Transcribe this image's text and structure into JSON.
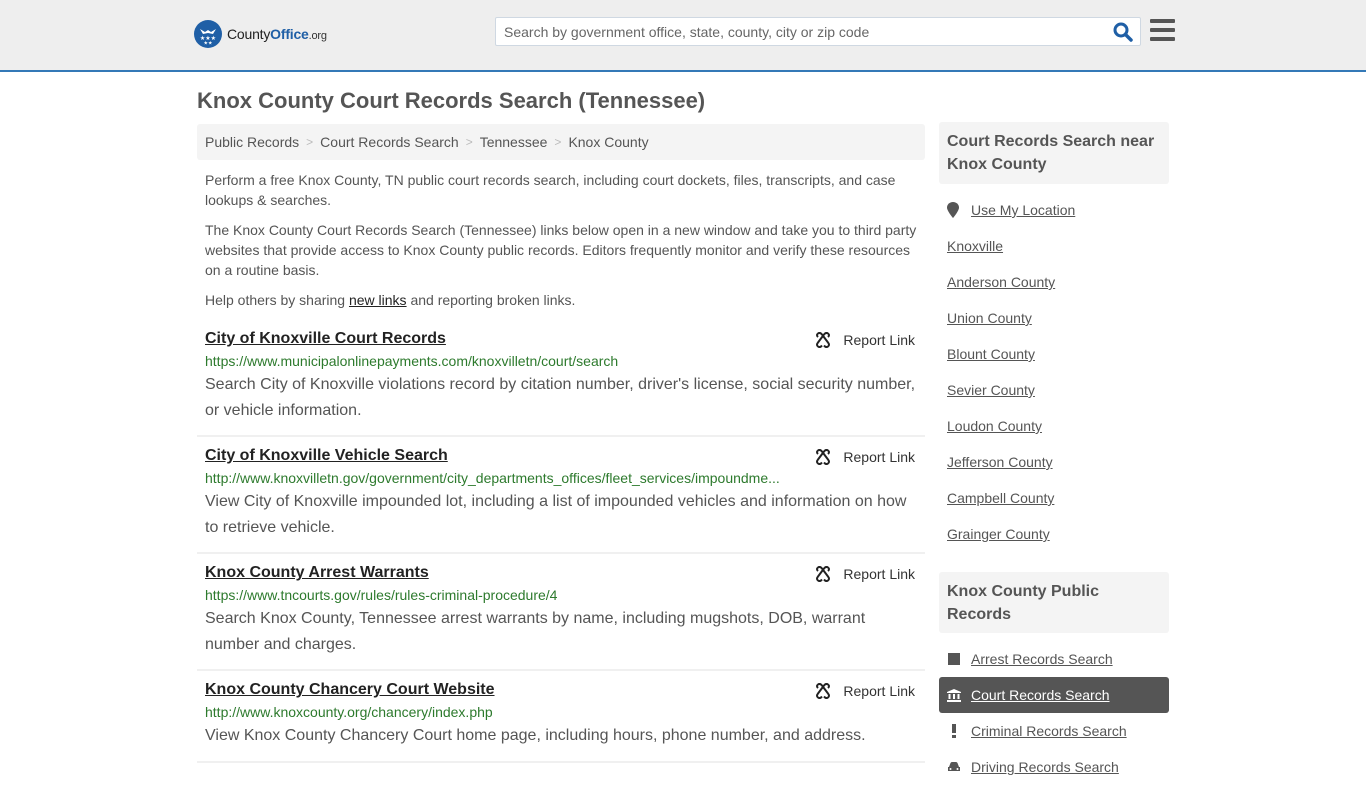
{
  "header": {
    "logo": {
      "name_part1": "County",
      "name_part2": "Office",
      "name_part3": ".org"
    },
    "search": {
      "placeholder": "Search by government office, state, county, city or zip code",
      "value": ""
    },
    "accent_color": "#3479b7"
  },
  "page": {
    "title": "Knox County Court Records Search (Tennessee)"
  },
  "breadcrumb": [
    {
      "label": "Public Records"
    },
    {
      "label": "Court Records Search"
    },
    {
      "label": "Tennessee"
    },
    {
      "label": "Knox County"
    }
  ],
  "intro": {
    "p1": "Perform a free Knox County, TN public court records search, including court dockets, files, transcripts, and case lookups & searches.",
    "p2": "The Knox County Court Records Search (Tennessee) links below open in a new window and take you to third party websites that provide access to Knox County public records. Editors frequently monitor and verify these resources on a routine basis.",
    "p3_before": "Help others by sharing ",
    "p3_link": "new links",
    "p3_after": " and reporting broken links."
  },
  "results": [
    {
      "title": "City of Knoxville Court Records",
      "url": "https://www.municipalonlinepayments.com/knoxvilletn/court/search",
      "description": "Search City of Knoxville violations record by citation number, driver's license, social security number, or vehicle information.",
      "report_label": "Report Link"
    },
    {
      "title": "City of Knoxville Vehicle Search",
      "url": "http://www.knoxvilletn.gov/government/city_departments_offices/fleet_services/impoundme...",
      "description": "View City of Knoxville impounded lot, including a list of impounded vehicles and information on how to retrieve vehicle.",
      "report_label": "Report Link"
    },
    {
      "title": "Knox County Arrest Warrants",
      "url": "https://www.tncourts.gov/rules/rules-criminal-procedure/4",
      "description": "Search Knox County, Tennessee arrest warrants by name, including mugshots, DOB, warrant number and charges.",
      "report_label": "Report Link"
    },
    {
      "title": "Knox County Chancery Court Website",
      "url": "http://www.knoxcounty.org/chancery/index.php",
      "description": "View Knox County Chancery Court home page, including hours, phone number, and address.",
      "report_label": "Report Link"
    }
  ],
  "sidebar": {
    "nearby": {
      "heading": "Court Records Search near Knox County",
      "use_location": "Use My Location",
      "items": [
        "Knoxville",
        "Anderson County",
        "Union County",
        "Blount County",
        "Sevier County",
        "Loudon County",
        "Jefferson County",
        "Campbell County",
        "Grainger County"
      ]
    },
    "public_records": {
      "heading": "Knox County Public Records",
      "items": [
        {
          "label": "Arrest Records Search",
          "icon": "square-icon",
          "active": false
        },
        {
          "label": "Court Records Search",
          "icon": "courthouse-icon",
          "active": true
        },
        {
          "label": "Criminal Records Search",
          "icon": "exclamation-icon",
          "active": false
        },
        {
          "label": "Driving Records Search",
          "icon": "car-icon",
          "active": false
        }
      ]
    }
  }
}
